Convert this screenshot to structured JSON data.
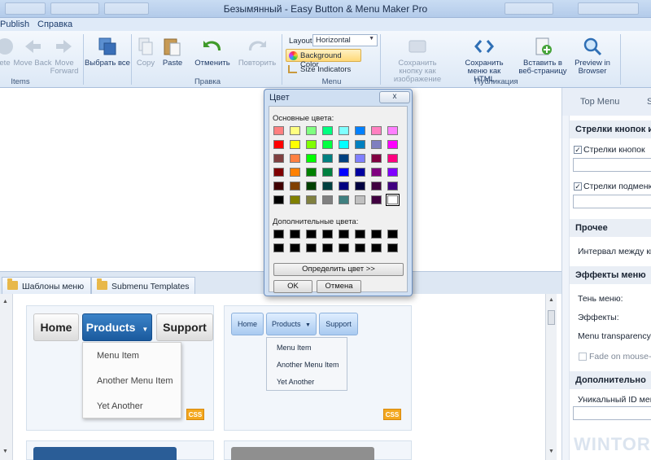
{
  "window": {
    "title": "Безымянный - Easy Button & Menu Maker Pro"
  },
  "menubar": {
    "items": [
      "Publish",
      "Справка"
    ]
  },
  "ribbon": {
    "items_group": {
      "label": "Items",
      "buttons": [
        "ete",
        "Move Back",
        "Move Forward"
      ]
    },
    "select_all": "Выбрать все",
    "edit_group": {
      "label": "Правка",
      "copy": "Copy",
      "paste": "Paste",
      "undo": "Отменить",
      "redo": "Повторить"
    },
    "menu_group": {
      "label": "Menu",
      "layout_label": "Layout",
      "layout_value": "Horizontal",
      "bg_color": "Background Color",
      "size_indicators": "Size Indicators"
    },
    "publish_group": {
      "label": "Публикация",
      "save_image": "Сохранить кнопку как изображение",
      "save_html": "Сохранить меню как HTML",
      "insert_web": "Вставить в веб-страницу",
      "preview": "Preview in Browser"
    }
  },
  "right_panel": {
    "tabs": [
      "Top Menu",
      "S"
    ],
    "sections": {
      "arrows_head": "Стрелки кнопок и м",
      "arrows_buttons": "Стрелки кнопок",
      "arrows_submenu": "Стрелки подменю",
      "other_head": "Прочее",
      "interval": "Интервал между кноп",
      "effects_head": "Эффекты меню",
      "shadow": "Тень меню:",
      "effects": "Эффекты:",
      "transparency": "Menu transparency:",
      "fade": "Fade on mouse-over",
      "extra_head": "Дополнительно",
      "unique_id": "Уникальный ID меню"
    }
  },
  "bottom_tabs": [
    "Шаблоны меню",
    "Submenu Templates"
  ],
  "templates": {
    "card1": {
      "buttons": [
        "Home",
        "Products",
        "Support"
      ],
      "submenu": [
        "Menu Item",
        "Another Menu Item",
        "Yet Another"
      ],
      "badge": "CSS"
    },
    "card2": {
      "buttons": [
        "Home",
        "Products",
        "Support"
      ],
      "submenu": [
        "Menu Item",
        "Another Menu Item",
        "Yet Another"
      ],
      "badge": "CSS"
    }
  },
  "color_dialog": {
    "title": "Цвет",
    "close": "x",
    "basic_label": "Основные цвета:",
    "custom_label": "Дополнительные цвета:",
    "define_button": "Определить цвет >>",
    "ok": "OK",
    "cancel": "Отмена",
    "basic_colors": [
      [
        "#ff8080",
        "#ffff80",
        "#80ff80",
        "#00ff80",
        "#80ffff",
        "#0080ff",
        "#ff80c0",
        "#ff80ff"
      ],
      [
        "#ff0000",
        "#ffff00",
        "#80ff00",
        "#00ff40",
        "#00ffff",
        "#0080c0",
        "#8080c0",
        "#ff00ff"
      ],
      [
        "#804040",
        "#ff8040",
        "#00ff00",
        "#008080",
        "#004080",
        "#8080ff",
        "#800040",
        "#ff0080"
      ],
      [
        "#800000",
        "#ff8000",
        "#008000",
        "#008040",
        "#0000ff",
        "#0000a0",
        "#800080",
        "#8000ff"
      ],
      [
        "#400000",
        "#804000",
        "#004000",
        "#004040",
        "#000080",
        "#000040",
        "#400040",
        "#400080"
      ],
      [
        "#000000",
        "#808000",
        "#808040",
        "#808080",
        "#408080",
        "#c0c0c0",
        "#400040",
        "#ffffff"
      ]
    ],
    "custom_colors": [
      "#000000",
      "#000000",
      "#000000",
      "#000000",
      "#000000",
      "#000000",
      "#000000",
      "#000000",
      "#000000",
      "#000000",
      "#000000",
      "#000000",
      "#000000",
      "#000000",
      "#000000",
      "#000000"
    ]
  },
  "watermark": "WINTOR"
}
